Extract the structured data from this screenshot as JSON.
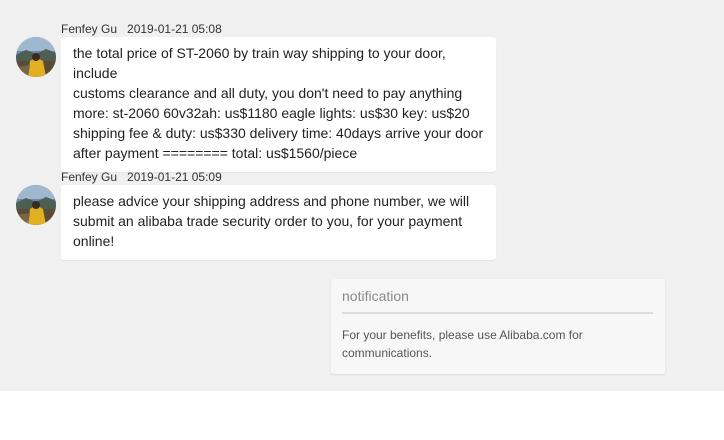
{
  "messages": [
    {
      "sender": "Fenfey Gu",
      "time": "2019-01-21 05:08",
      "lines": [
        "the total price of ST-2060 by train way shipping to your door, include",
        "customs clearance and all duty, you don't need to pay anything",
        "more: st-2060 60v32ah: us$1180 eagle lights: us$30 key: us$20",
        "shipping fee & duty: us$330 delivery time: 40days arrive your door",
        "after payment ======== total: us$1560/piece"
      ]
    },
    {
      "sender": "Fenfey Gu",
      "time": "2019-01-21 05:09",
      "lines": [
        "please advice your shipping address and phone number, we will",
        "submit an alibaba trade security order to you, for your payment",
        "online!"
      ]
    }
  ],
  "notification": {
    "title": "notification",
    "body_lines": [
      "For your benefits, please use Alibaba.com for",
      "communications."
    ]
  },
  "colors": {
    "chat_background": "#f0f0f0",
    "bubble_background": "#ffffff",
    "notice_background": "#f7f7f7"
  }
}
